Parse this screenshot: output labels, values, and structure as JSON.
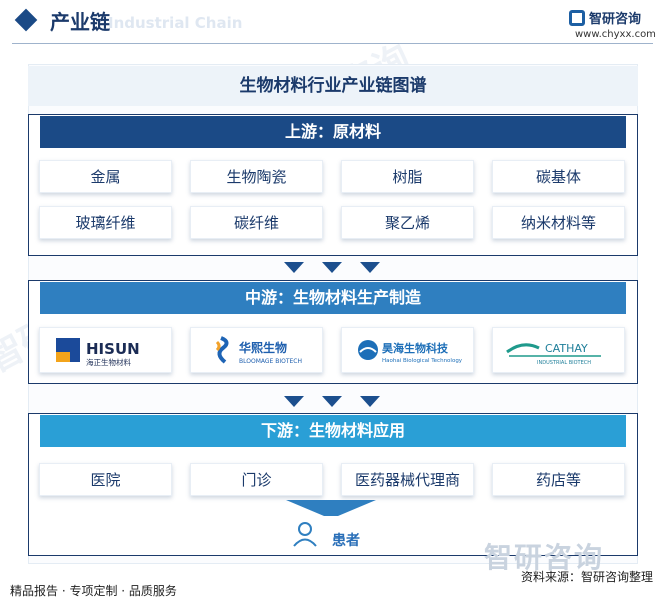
{
  "header": {
    "title": "产业链",
    "title_en": "Industrial Chain",
    "logo_name": "智研咨询",
    "site": "www.chyxx.com"
  },
  "diagram": {
    "title": "生物材料行业产业链图谱",
    "upstream": {
      "label": "上游：原材料",
      "items": [
        "金属",
        "生物陶瓷",
        "树脂",
        "碳基体",
        "玻璃纤维",
        "碳纤维",
        "聚乙烯",
        "纳米材料等"
      ]
    },
    "midstream": {
      "label": "中游：生物材料生产制造",
      "companies": [
        {
          "name": "HISUN",
          "sub": "海正生物材料"
        },
        {
          "name": "华熙生物",
          "sub": "BLOOMAGE BIOTECH"
        },
        {
          "name": "昊海生物科技",
          "sub": "Haohai Biological Technology"
        },
        {
          "name": "CATHAY",
          "sub": "INDUSTRIAL BIOTECH"
        }
      ]
    },
    "downstream": {
      "label": "下游：生物材料应用",
      "items": [
        "医院",
        "门诊",
        "医药器械代理商",
        "药店等"
      ]
    },
    "end_user": "患者"
  },
  "footer": {
    "left": "精品报告 · 专项定制 · 品质服务",
    "right": "资料来源：智研咨询整理",
    "watermark": "智研咨询"
  },
  "colors": {
    "upstream_band": "#1b4a86",
    "midstream_band": "#2f7fc0",
    "downstream_band": "#2a9fd6",
    "arrow": "#1c4f8e"
  }
}
